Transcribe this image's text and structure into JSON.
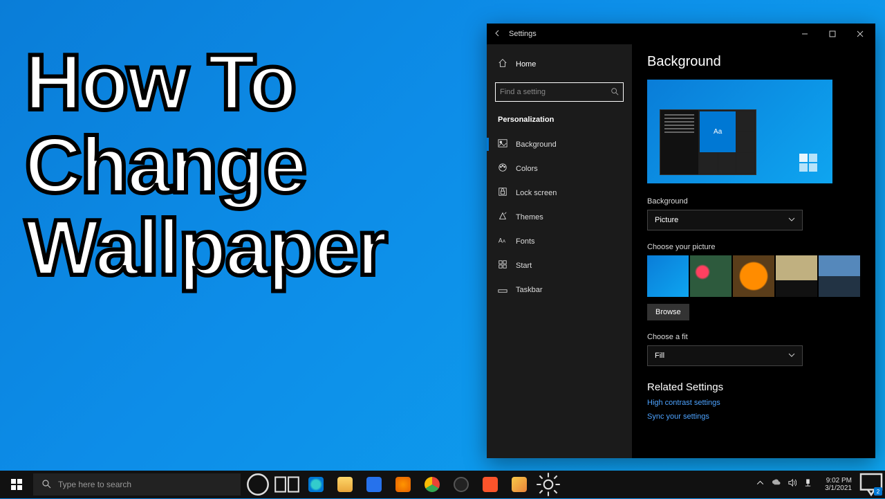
{
  "overlay": {
    "line1": "How To",
    "line2": "Change",
    "line3": "Wallpaper"
  },
  "window": {
    "title": "Settings",
    "sidebar": {
      "home": "Home",
      "search_placeholder": "Find a setting",
      "section": "Personalization",
      "items": [
        {
          "label": "Background",
          "icon": "picture-icon",
          "active": true
        },
        {
          "label": "Colors",
          "icon": "palette-icon",
          "active": false
        },
        {
          "label": "Lock screen",
          "icon": "lock-icon",
          "active": false
        },
        {
          "label": "Themes",
          "icon": "themes-icon",
          "active": false
        },
        {
          "label": "Fonts",
          "icon": "fonts-icon",
          "active": false
        },
        {
          "label": "Start",
          "icon": "start-icon",
          "active": false
        },
        {
          "label": "Taskbar",
          "icon": "taskbar-icon",
          "active": false
        }
      ]
    },
    "main": {
      "title": "Background",
      "preview_sample": "Aa",
      "bg_label": "Background",
      "bg_value": "Picture",
      "choose_picture_label": "Choose your picture",
      "browse": "Browse",
      "fit_label": "Choose a fit",
      "fit_value": "Fill",
      "related_title": "Related Settings",
      "links": [
        "High contrast settings",
        "Sync your settings"
      ]
    }
  },
  "taskbar": {
    "search_placeholder": "Type here to search",
    "time": "9:02 PM",
    "date": "3/1/2021",
    "notif_count": "2"
  }
}
